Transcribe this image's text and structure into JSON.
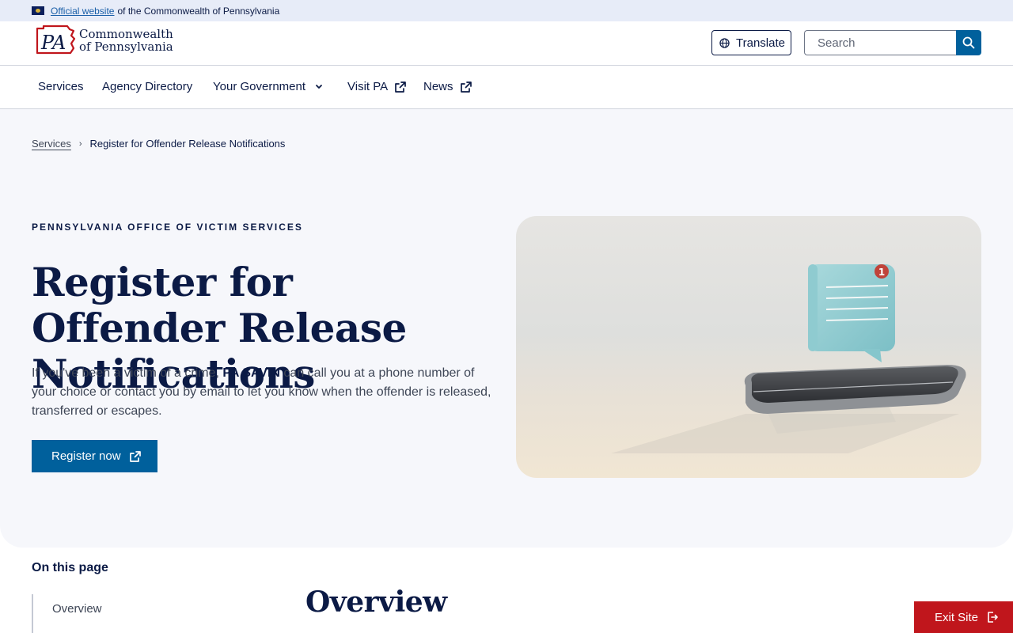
{
  "gov_banner": {
    "link_text": "Official website",
    "rest_text": "of the Commonwealth of Pennsylvania"
  },
  "header": {
    "logo_line1": "Commonwealth",
    "logo_line2": "of Pennsylvania",
    "logo_mark_text": "PA",
    "translate_label": "Translate",
    "search_placeholder": "Search"
  },
  "nav": {
    "items": [
      {
        "label": "Services"
      },
      {
        "label": "Agency Directory"
      },
      {
        "label": "Your Government"
      },
      {
        "label": "Visit PA"
      },
      {
        "label": "News"
      }
    ]
  },
  "breadcrumb": {
    "parent": "Services",
    "current": "Register for Offender Release Notifications"
  },
  "hero": {
    "eyebrow": "PENNSYLVANIA OFFICE OF VICTIM SERVICES",
    "title": "Register for Offender Release Notifications",
    "desc_before": "If you've been a victim of a crime, ",
    "desc_bold": "PA SAVIN",
    "desc_after": " can call you at a phone number of your choice or contact you by email to let you know when the offender is released, transferred or escapes.",
    "button_label": "Register now",
    "notification_count": "1"
  },
  "on_this_page": {
    "title": "On this page",
    "items": [
      {
        "label": "Overview"
      }
    ]
  },
  "overview_title": "Overview",
  "exit_label": "Exit Site",
  "colors": {
    "navy": "#0b1a45",
    "primary_blue": "#00609c",
    "exit_red": "#c0161c",
    "hero_bg": "#f6f7fb",
    "banner_bg": "#e7ecf8"
  }
}
